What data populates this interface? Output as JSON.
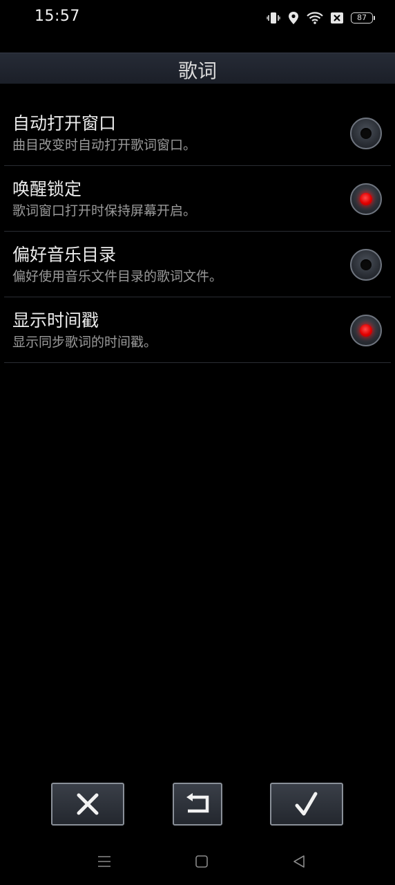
{
  "status_bar": {
    "time": "15:57",
    "battery_level": "87",
    "icons": [
      "vibrate-icon",
      "location-icon",
      "wifi-icon",
      "sim-blocked-icon",
      "battery-icon"
    ]
  },
  "header": {
    "title": "歌词"
  },
  "settings": [
    {
      "title": "自动打开窗口",
      "description": "曲目改变时自动打开歌词窗口。",
      "enabled": false
    },
    {
      "title": "唤醒锁定",
      "description": "歌词窗口打开时保持屏幕开启。",
      "enabled": true
    },
    {
      "title": "偏好音乐目录",
      "description": "偏好使用音乐文件目录的歌词文件。",
      "enabled": false
    },
    {
      "title": "显示时间戳",
      "description": "显示同步歌词的时间戳。",
      "enabled": true
    }
  ],
  "actions": {
    "cancel_icon": "close-icon",
    "reset_icon": "undo-icon",
    "confirm_icon": "checkmark-icon"
  },
  "navigation": {
    "items": [
      "menu-icon",
      "home-icon",
      "back-icon"
    ]
  },
  "colors": {
    "background": "#000000",
    "title_bar": "#1f232c",
    "radio_on": "#e00000"
  }
}
